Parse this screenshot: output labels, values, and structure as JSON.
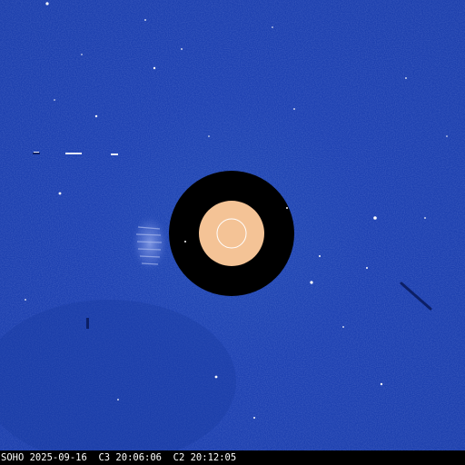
{
  "caption": "SOHO 2025-09-16  C3 20:06:06  C2 20:12:05",
  "colors": {
    "sky": "#2147b4",
    "occulter": "#000000",
    "sun_disk": "#f4c396",
    "sun_outline": "#ffffff",
    "caption_text": "#ffffff",
    "caption_bg": "#000000"
  }
}
